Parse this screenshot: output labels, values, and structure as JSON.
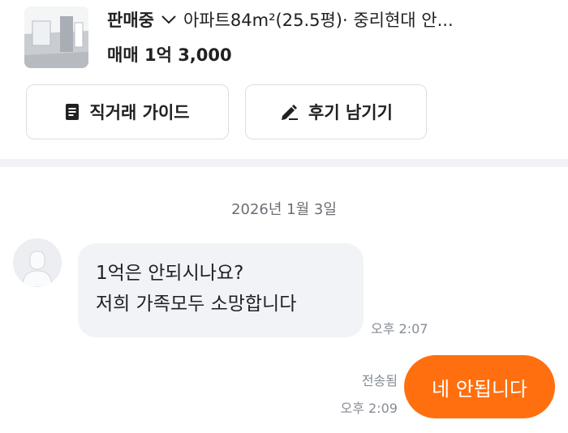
{
  "listing": {
    "status": "판매중",
    "summary": "아파트84m²(25.5평)· 중리현대 안...",
    "price": "매매 1억 3,000"
  },
  "actions": {
    "guide_label": "직거래 가이드",
    "review_label": "후기 남기기"
  },
  "chat": {
    "date": "2026년 1월 3일",
    "incoming": {
      "lines": [
        "1억은 안되시나요?",
        "저희 가족모두 소망합니다"
      ],
      "time": "오후 2:07"
    },
    "outgoing": {
      "text": "네 안됩니다",
      "status": "전송됨",
      "time": "오후 2:09"
    }
  },
  "colors": {
    "accent": "#ff6f0f",
    "bubble_in": "#f2f3f6",
    "meta_text": "#868b94"
  }
}
